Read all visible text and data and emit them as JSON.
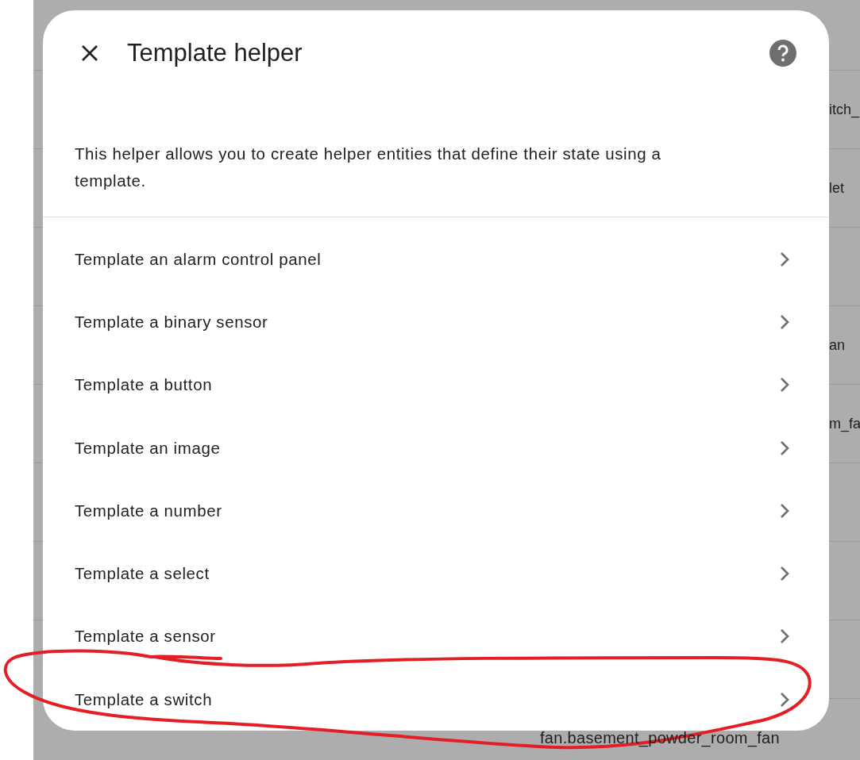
{
  "background_list": {
    "rows": [
      {
        "text": ""
      },
      {
        "text": "itch_"
      },
      {
        "text": "let"
      },
      {
        "text": ""
      },
      {
        "text": "an"
      },
      {
        "text": "m_fa"
      },
      {
        "text": ""
      },
      {
        "text": ""
      },
      {
        "text": ""
      },
      {
        "text": "fan.basement_powder_room_fan",
        "kind": "visible"
      }
    ]
  },
  "dialog": {
    "title": "Template helper",
    "description": "This helper allows you to create helper entities that define their state using a template.",
    "options": [
      {
        "label": "Template an alarm control panel"
      },
      {
        "label": "Template a binary sensor"
      },
      {
        "label": "Template a button"
      },
      {
        "label": "Template an image"
      },
      {
        "label": "Template a number"
      },
      {
        "label": "Template a select"
      },
      {
        "label": "Template a sensor"
      },
      {
        "label": "Template a switch"
      }
    ]
  }
}
